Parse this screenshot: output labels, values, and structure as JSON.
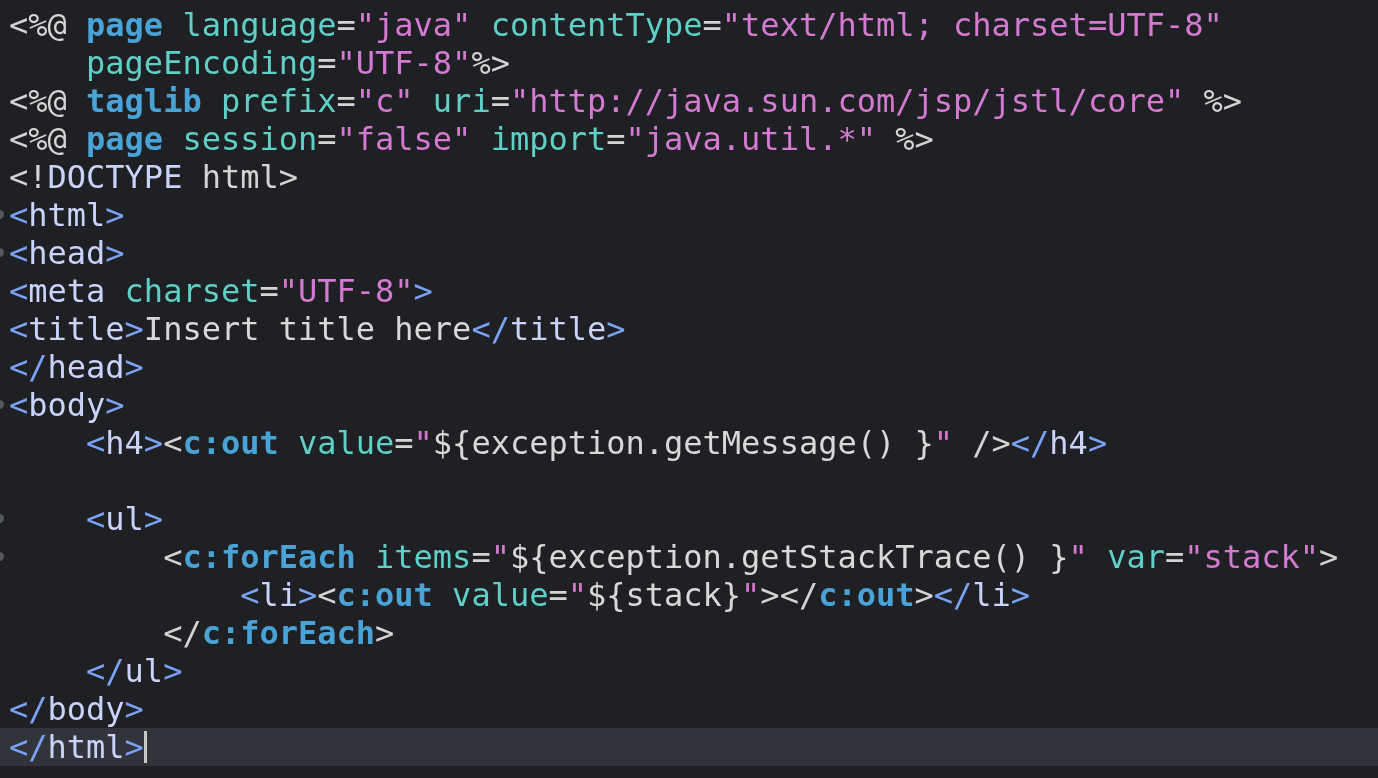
{
  "editor": {
    "lines": [
      {
        "fold": false,
        "current": false,
        "tokens": [
          {
            "kind": "p",
            "text": "<%@ "
          },
          {
            "kind": "d",
            "text": "page"
          },
          {
            "kind": "a",
            "text": " language"
          },
          {
            "kind": "p",
            "text": "="
          },
          {
            "kind": "s",
            "text": "\"java\""
          },
          {
            "kind": "a",
            "text": " contentType"
          },
          {
            "kind": "p",
            "text": "="
          },
          {
            "kind": "s",
            "text": "\"text/html; charset=UTF-8\""
          }
        ]
      },
      {
        "fold": false,
        "current": false,
        "tokens": [
          {
            "kind": "a",
            "text": "    pageEncoding"
          },
          {
            "kind": "p",
            "text": "="
          },
          {
            "kind": "s",
            "text": "\"UTF-8\""
          },
          {
            "kind": "p",
            "text": "%>"
          }
        ]
      },
      {
        "fold": false,
        "current": false,
        "tokens": [
          {
            "kind": "p",
            "text": "<%@ "
          },
          {
            "kind": "d",
            "text": "taglib"
          },
          {
            "kind": "a",
            "text": " prefix"
          },
          {
            "kind": "p",
            "text": "="
          },
          {
            "kind": "s",
            "text": "\"c\""
          },
          {
            "kind": "a",
            "text": " uri"
          },
          {
            "kind": "p",
            "text": "="
          },
          {
            "kind": "s",
            "text": "\"http://java.sun.com/jsp/jstl/core\""
          },
          {
            "kind": "p",
            "text": " %>"
          }
        ]
      },
      {
        "fold": false,
        "current": false,
        "tokens": [
          {
            "kind": "p",
            "text": "<%@ "
          },
          {
            "kind": "d",
            "text": "page"
          },
          {
            "kind": "a",
            "text": " session"
          },
          {
            "kind": "p",
            "text": "="
          },
          {
            "kind": "s",
            "text": "\"false\""
          },
          {
            "kind": "a",
            "text": " import"
          },
          {
            "kind": "p",
            "text": "="
          },
          {
            "kind": "s",
            "text": "\"java.util.*\""
          },
          {
            "kind": "p",
            "text": " %>"
          }
        ]
      },
      {
        "fold": false,
        "current": false,
        "tokens": [
          {
            "kind": "p",
            "text": "<!"
          },
          {
            "kind": "n",
            "text": "DOCTYPE"
          },
          {
            "kind": "p",
            "text": " html>"
          }
        ]
      },
      {
        "fold": true,
        "current": false,
        "tokens": [
          {
            "kind": "b",
            "text": "<"
          },
          {
            "kind": "n",
            "text": "html"
          },
          {
            "kind": "b",
            "text": ">"
          }
        ]
      },
      {
        "fold": true,
        "current": false,
        "tokens": [
          {
            "kind": "b",
            "text": "<"
          },
          {
            "kind": "n",
            "text": "head"
          },
          {
            "kind": "b",
            "text": ">"
          }
        ]
      },
      {
        "fold": false,
        "current": false,
        "tokens": [
          {
            "kind": "b",
            "text": "<"
          },
          {
            "kind": "n",
            "text": "meta"
          },
          {
            "kind": "a",
            "text": " charset"
          },
          {
            "kind": "p",
            "text": "="
          },
          {
            "kind": "s",
            "text": "\"UTF-8\""
          },
          {
            "kind": "b",
            "text": ">"
          }
        ]
      },
      {
        "fold": false,
        "current": false,
        "tokens": [
          {
            "kind": "b",
            "text": "<"
          },
          {
            "kind": "n",
            "text": "title"
          },
          {
            "kind": "b",
            "text": ">"
          },
          {
            "kind": "t",
            "text": "Insert title here"
          },
          {
            "kind": "b",
            "text": "</"
          },
          {
            "kind": "n",
            "text": "title"
          },
          {
            "kind": "b",
            "text": ">"
          }
        ]
      },
      {
        "fold": false,
        "current": false,
        "tokens": [
          {
            "kind": "b",
            "text": "</"
          },
          {
            "kind": "n",
            "text": "head"
          },
          {
            "kind": "b",
            "text": ">"
          }
        ]
      },
      {
        "fold": true,
        "current": false,
        "tokens": [
          {
            "kind": "b",
            "text": "<"
          },
          {
            "kind": "n",
            "text": "body"
          },
          {
            "kind": "b",
            "text": ">"
          }
        ]
      },
      {
        "fold": false,
        "current": false,
        "tokens": [
          {
            "kind": "b",
            "text": "    <"
          },
          {
            "kind": "n",
            "text": "h4"
          },
          {
            "kind": "b",
            "text": ">"
          },
          {
            "kind": "p",
            "text": "<"
          },
          {
            "kind": "j",
            "text": "c:out"
          },
          {
            "kind": "a",
            "text": " value"
          },
          {
            "kind": "p",
            "text": "="
          },
          {
            "kind": "s",
            "text": "\""
          },
          {
            "kind": "t",
            "text": "${exception.getMessage() }"
          },
          {
            "kind": "s",
            "text": "\""
          },
          {
            "kind": "p",
            "text": " />"
          },
          {
            "kind": "b",
            "text": "</"
          },
          {
            "kind": "n",
            "text": "h4"
          },
          {
            "kind": "b",
            "text": ">"
          }
        ]
      },
      {
        "fold": false,
        "current": false
      },
      {
        "fold": true,
        "current": false,
        "tokens": [
          {
            "kind": "b",
            "text": "    <"
          },
          {
            "kind": "n",
            "text": "ul"
          },
          {
            "kind": "b",
            "text": ">"
          }
        ]
      },
      {
        "fold": true,
        "current": false,
        "tokens": [
          {
            "kind": "p",
            "text": "        <"
          },
          {
            "kind": "j",
            "text": "c:forEach"
          },
          {
            "kind": "a",
            "text": " items"
          },
          {
            "kind": "p",
            "text": "="
          },
          {
            "kind": "s",
            "text": "\""
          },
          {
            "kind": "t",
            "text": "${exception.getStackTrace() }"
          },
          {
            "kind": "s",
            "text": "\""
          },
          {
            "kind": "a",
            "text": " var"
          },
          {
            "kind": "p",
            "text": "="
          },
          {
            "kind": "s",
            "text": "\"stack\""
          },
          {
            "kind": "p",
            "text": ">"
          }
        ]
      },
      {
        "fold": false,
        "current": false,
        "tokens": [
          {
            "kind": "b",
            "text": "            <"
          },
          {
            "kind": "n",
            "text": "li"
          },
          {
            "kind": "b",
            "text": ">"
          },
          {
            "kind": "p",
            "text": "<"
          },
          {
            "kind": "j",
            "text": "c:out"
          },
          {
            "kind": "a",
            "text": " value"
          },
          {
            "kind": "p",
            "text": "="
          },
          {
            "kind": "s",
            "text": "\""
          },
          {
            "kind": "t",
            "text": "${stack}"
          },
          {
            "kind": "s",
            "text": "\""
          },
          {
            "kind": "p",
            "text": "></"
          },
          {
            "kind": "j",
            "text": "c:out"
          },
          {
            "kind": "p",
            "text": ">"
          },
          {
            "kind": "b",
            "text": "</"
          },
          {
            "kind": "n",
            "text": "li"
          },
          {
            "kind": "b",
            "text": ">"
          }
        ]
      },
      {
        "fold": false,
        "current": false,
        "tokens": [
          {
            "kind": "p",
            "text": "        </"
          },
          {
            "kind": "j",
            "text": "c:forEach"
          },
          {
            "kind": "p",
            "text": ">"
          }
        ]
      },
      {
        "fold": false,
        "current": false,
        "tokens": [
          {
            "kind": "b",
            "text": "    </"
          },
          {
            "kind": "n",
            "text": "ul"
          },
          {
            "kind": "b",
            "text": ">"
          }
        ]
      },
      {
        "fold": false,
        "current": false,
        "tokens": [
          {
            "kind": "b",
            "text": "</"
          },
          {
            "kind": "n",
            "text": "body"
          },
          {
            "kind": "b",
            "text": ">"
          }
        ]
      },
      {
        "fold": false,
        "current": true,
        "tokens": [
          {
            "kind": "b",
            "text": "</"
          },
          {
            "kind": "n",
            "text": "html"
          },
          {
            "kind": "b",
            "text": ">"
          }
        ]
      }
    ]
  }
}
